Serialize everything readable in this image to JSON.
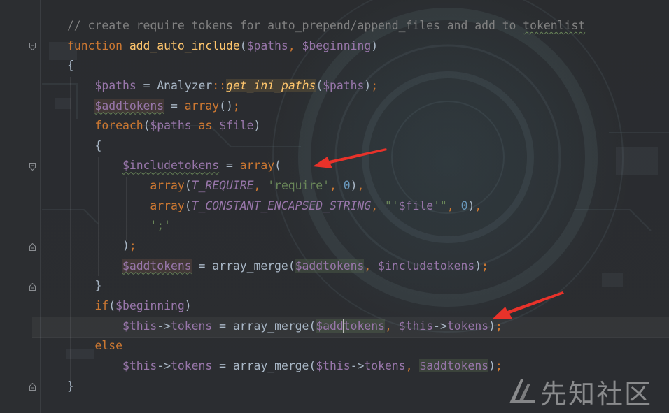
{
  "editor": {
    "lines": [
      [
        {
          "t": "// create require tokens for auto_prepend/append_files and add to ",
          "c": "cmt"
        },
        {
          "t": "tokenlist",
          "c": "cmt uw"
        }
      ],
      [
        {
          "t": "function ",
          "c": "kw"
        },
        {
          "t": "add_auto_include",
          "c": "fn"
        },
        {
          "t": "(",
          "c": "cls"
        },
        {
          "t": "$paths",
          "c": "var"
        },
        {
          "t": ", ",
          "c": "kw"
        },
        {
          "t": "$beginning",
          "c": "var"
        },
        {
          "t": ")",
          "c": "cls"
        }
      ],
      [
        {
          "t": "{",
          "c": "cls"
        }
      ],
      [
        {
          "t": "    ",
          "c": "cls"
        },
        {
          "t": "$paths",
          "c": "var"
        },
        {
          "t": " = ",
          "c": "cls"
        },
        {
          "t": "Analyzer",
          "c": "cls"
        },
        {
          "t": "::",
          "c": "kw"
        },
        {
          "t": "get_ini_paths",
          "c": "stat"
        },
        {
          "t": "(",
          "c": "cls"
        },
        {
          "t": "$paths",
          "c": "var"
        },
        {
          "t": ")",
          "c": "cls"
        },
        {
          "t": ";",
          "c": "kw"
        }
      ],
      [
        {
          "t": "    ",
          "c": "cls"
        },
        {
          "t": "$addtokens",
          "c": "var hlr uw"
        },
        {
          "t": " = ",
          "c": "cls"
        },
        {
          "t": "array",
          "c": "kw"
        },
        {
          "t": "()",
          "c": "cls"
        },
        {
          "t": ";",
          "c": "kw"
        }
      ],
      [
        {
          "t": "    ",
          "c": "cls"
        },
        {
          "t": "foreach",
          "c": "kw"
        },
        {
          "t": "(",
          "c": "cls"
        },
        {
          "t": "$paths",
          "c": "var"
        },
        {
          "t": " as ",
          "c": "kw"
        },
        {
          "t": "$file",
          "c": "var"
        },
        {
          "t": ")",
          "c": "cls"
        }
      ],
      [
        {
          "t": "    {",
          "c": "cls"
        }
      ],
      [
        {
          "t": "        ",
          "c": "cls"
        },
        {
          "t": "$includetokens",
          "c": "var uw"
        },
        {
          "t": " = ",
          "c": "cls"
        },
        {
          "t": "array",
          "c": "kw"
        },
        {
          "t": "(",
          "c": "cls"
        }
      ],
      [
        {
          "t": "            ",
          "c": "cls"
        },
        {
          "t": "array",
          "c": "kw"
        },
        {
          "t": "(",
          "c": "cls"
        },
        {
          "t": "T_REQUIRE",
          "c": "const"
        },
        {
          "t": ", ",
          "c": "kw"
        },
        {
          "t": "'require'",
          "c": "str"
        },
        {
          "t": ", ",
          "c": "kw"
        },
        {
          "t": "0",
          "c": "num"
        },
        {
          "t": ")",
          "c": "cls"
        },
        {
          "t": ",",
          "c": "kw"
        }
      ],
      [
        {
          "t": "            ",
          "c": "cls"
        },
        {
          "t": "array",
          "c": "kw"
        },
        {
          "t": "(",
          "c": "cls"
        },
        {
          "t": "T_CONSTANT_ENCAPSED_STRING",
          "c": "const"
        },
        {
          "t": ", ",
          "c": "kw"
        },
        {
          "t": "\"'",
          "c": "str"
        },
        {
          "t": "$file",
          "c": "var"
        },
        {
          "t": "'\"",
          "c": "str"
        },
        {
          "t": ", ",
          "c": "kw"
        },
        {
          "t": "0",
          "c": "num"
        },
        {
          "t": ")",
          "c": "cls"
        },
        {
          "t": ",",
          "c": "kw"
        }
      ],
      [
        {
          "t": "            ",
          "c": "cls"
        },
        {
          "t": "';'",
          "c": "str"
        }
      ],
      [
        {
          "t": "        )",
          "c": "cls"
        },
        {
          "t": ";",
          "c": "kw"
        }
      ],
      [
        {
          "t": "        ",
          "c": "cls"
        },
        {
          "t": "$addtokens",
          "c": "var hlr uw"
        },
        {
          "t": " = ",
          "c": "cls"
        },
        {
          "t": "array_merge",
          "c": "cls"
        },
        {
          "t": "(",
          "c": "cls"
        },
        {
          "t": "$addtokens",
          "c": "var hl"
        },
        {
          "t": ", ",
          "c": "kw"
        },
        {
          "t": "$includetokens",
          "c": "var"
        },
        {
          "t": ")",
          "c": "cls"
        },
        {
          "t": ";",
          "c": "kw"
        }
      ],
      [
        {
          "t": "    }",
          "c": "cls"
        }
      ],
      [
        {
          "t": "    ",
          "c": "cls"
        },
        {
          "t": "if",
          "c": "kw"
        },
        {
          "t": "(",
          "c": "cls"
        },
        {
          "t": "$beginning",
          "c": "var"
        },
        {
          "t": ")",
          "c": "cls"
        }
      ],
      [
        {
          "t": "        ",
          "c": "cls"
        },
        {
          "t": "$this",
          "c": "var"
        },
        {
          "t": "->",
          "c": "cls"
        },
        {
          "t": "tokens",
          "c": "var"
        },
        {
          "t": " = ",
          "c": "cls"
        },
        {
          "t": "array_merge",
          "c": "cls"
        },
        {
          "t": "(",
          "c": "cls"
        },
        {
          "t": "$add",
          "c": "var hl"
        },
        {
          "t": "|",
          "c": "caret"
        },
        {
          "t": "tokens",
          "c": "var hl"
        },
        {
          "t": ", ",
          "c": "kw"
        },
        {
          "t": "$this",
          "c": "var"
        },
        {
          "t": "->",
          "c": "cls"
        },
        {
          "t": "tokens",
          "c": "var"
        },
        {
          "t": ")",
          "c": "cls"
        },
        {
          "t": ";",
          "c": "kw"
        }
      ],
      [
        {
          "t": "    ",
          "c": "cls"
        },
        {
          "t": "else",
          "c": "kw"
        }
      ],
      [
        {
          "t": "        ",
          "c": "cls"
        },
        {
          "t": "$this",
          "c": "var"
        },
        {
          "t": "->",
          "c": "cls"
        },
        {
          "t": "tokens",
          "c": "var"
        },
        {
          "t": " = ",
          "c": "cls"
        },
        {
          "t": "array_merge",
          "c": "cls"
        },
        {
          "t": "(",
          "c": "cls"
        },
        {
          "t": "$this",
          "c": "var"
        },
        {
          "t": "->",
          "c": "cls"
        },
        {
          "t": "tokens",
          "c": "var"
        },
        {
          "t": ", ",
          "c": "kw"
        },
        {
          "t": "$addtokens",
          "c": "var hl"
        },
        {
          "t": ")",
          "c": "cls"
        },
        {
          "t": ";",
          "c": "kw"
        }
      ],
      [
        {
          "t": "}",
          "c": "cls"
        }
      ]
    ]
  },
  "annotations": {
    "arrow_color": "#e8322a"
  },
  "watermark": {
    "text": "先知社区"
  },
  "colors": {
    "background": "#2b2d30",
    "keyword": "#cc7832",
    "function": "#ffc66d",
    "variable": "#9876aa",
    "string": "#6a8759",
    "number": "#6897bb",
    "comment": "#808080"
  }
}
